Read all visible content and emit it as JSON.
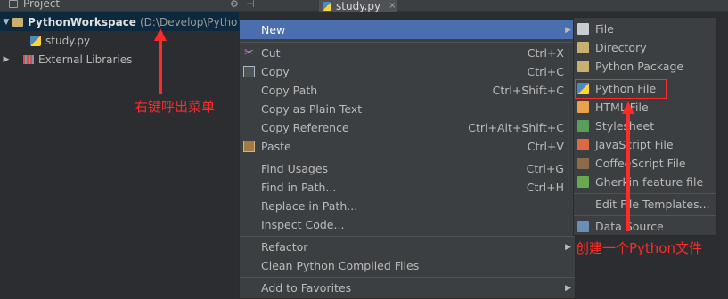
{
  "topbar": {
    "project_tab": "Project",
    "editor_tab": "study.py",
    "close_glyph": "×"
  },
  "tree": {
    "root_name": "PythonWorkspace",
    "root_path": "(D:\\Develop\\Pytho",
    "child_file": "study.py",
    "external_libs": "External Libraries"
  },
  "annotations": {
    "right_click": "右键呼出菜单",
    "create_file": "创建一个Python文件"
  },
  "menu": {
    "items": [
      {
        "label": "New",
        "shortcut": "",
        "submenu": true
      },
      {
        "label": "Cut",
        "shortcut": "Ctrl+X",
        "icon": "scissors-icon"
      },
      {
        "label": "Copy",
        "shortcut": "Ctrl+C",
        "icon": "copy-icon"
      },
      {
        "label": "Copy Path",
        "shortcut": "Ctrl+Shift+C"
      },
      {
        "label": "Copy as Plain Text",
        "shortcut": ""
      },
      {
        "label": "Copy Reference",
        "shortcut": "Ctrl+Alt+Shift+C"
      },
      {
        "label": "Paste",
        "shortcut": "Ctrl+V",
        "icon": "clipboard-icon"
      },
      {
        "label": "Find Usages",
        "shortcut": "Ctrl+G"
      },
      {
        "label": "Find in Path...",
        "shortcut": "Ctrl+H"
      },
      {
        "label": "Replace in Path...",
        "shortcut": ""
      },
      {
        "label": "Inspect Code...",
        "shortcut": ""
      },
      {
        "label": "Refactor",
        "shortcut": "",
        "submenu": true
      },
      {
        "label": "Clean Python Compiled Files",
        "shortcut": ""
      },
      {
        "label": "Add to Favorites",
        "shortcut": "",
        "submenu": true
      }
    ]
  },
  "submenu": {
    "items": [
      {
        "label": "File",
        "icon_color": "#c8cdd2"
      },
      {
        "label": "Directory",
        "icon_color": "#c9b071"
      },
      {
        "label": "Python Package",
        "icon_color": "#c9b071"
      },
      {
        "label": "Python File",
        "icon_color": "#4b8bbe"
      },
      {
        "label": "HTML File",
        "icon_color": "#e8a34a"
      },
      {
        "label": "Stylesheet",
        "icon_color": "#5a9e5a"
      },
      {
        "label": "JavaScript File",
        "icon_color": "#d96a44"
      },
      {
        "label": "CoffeeScript File",
        "icon_color": "#8b6b4a"
      },
      {
        "label": "Gherkin feature file",
        "icon_color": "#6aa84f"
      },
      {
        "label": "Edit File Templates...",
        "icon_color": ""
      },
      {
        "label": "Data Source",
        "icon_color": "#6a8fb5"
      }
    ]
  },
  "colors": {
    "menu_bg": "#3c3f41",
    "highlight": "#4b6eaf",
    "annotation": "#ff2a2a"
  }
}
